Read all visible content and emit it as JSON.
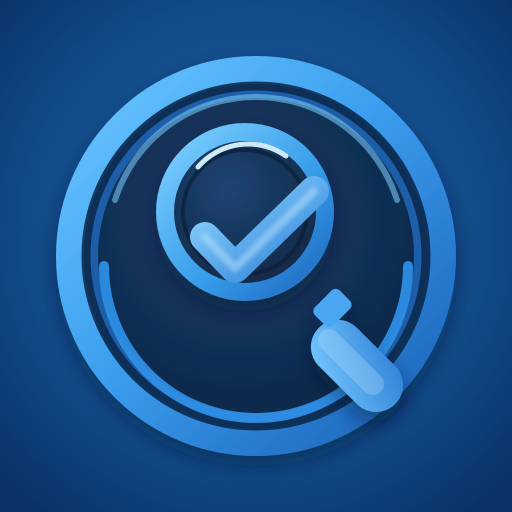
{
  "icon": {
    "semantic": "search-check-icon",
    "parts": [
      "background",
      "outer-ring",
      "inner-disc",
      "magnifier-lens",
      "check-mark",
      "magnifier-handle"
    ],
    "colors": {
      "background_center": "#1f5ea0",
      "background_edge": "#0a3168",
      "ring_light": "#6cc7ff",
      "ring_mid": "#2f8fe0",
      "ring_dark": "#1a5fb6",
      "disc_dark": "#0d2747",
      "disc_mid": "#173d6a",
      "lens_glass": "#10253f",
      "check_light": "#8fd4ff",
      "check_dark": "#2d82d8",
      "handle_light": "#77c8ff",
      "handle_dark": "#2e7fd6"
    }
  }
}
